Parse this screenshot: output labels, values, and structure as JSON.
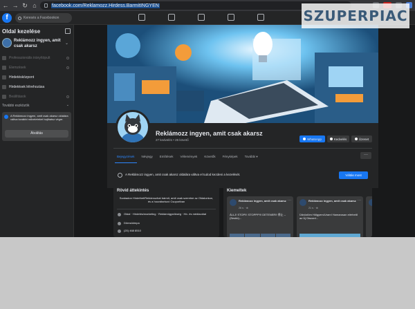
{
  "browser": {
    "url": "facebook.com/Reklamozz.Hirdess.BarmitINGYEN"
  },
  "watermark": "SZUPERPIAC",
  "fb": {
    "logo": "f",
    "search_placeholder": "Keresés a Facebookon"
  },
  "sidebar": {
    "title": "Oldal kezelése",
    "page_name": "Reklámozz ingyen, amit csak akarsz",
    "items": [
      {
        "label": "Professzionális irányítópult",
        "dim": true
      },
      {
        "label": "Elemzések",
        "dim": true
      },
      {
        "label": "Hirdetésközpont",
        "dim": false
      },
      {
        "label": "Hirdetések létrehozása",
        "dim": false
      },
      {
        "label": "Beállítások",
        "dim": true
      }
    ],
    "more_tools": "További eszközök",
    "notice_text": "A Reklámozz ingyen, amit csak akarsz oldalára váltva további műveleteket hajthatsz végre.",
    "switch_button": "Átváltás"
  },
  "page": {
    "name": "Reklámozz ingyen, amit csak akarsz",
    "stats": "27 kedvelés • 26 követő",
    "buttons": {
      "whatsapp": "WhatsApp",
      "like": "Kedvelés",
      "message": "Üzenet"
    },
    "tabs": [
      "Bejegyzések",
      "Névjegy",
      "Említések",
      "Vélemények",
      "Követők",
      "Fényképek",
      "További ▾"
    ],
    "tab_more": "···",
    "banner_text": "A Reklámozz ingyen, amit csak akarsz oldalára váltva el tudod kezdeni a kezelését.",
    "banner_button": "Váltás most"
  },
  "intro": {
    "title": "Rövid áttekintés",
    "description": "Szabadon Hirdethet/Reklámozhat bármit, amit csak szeretne az Oldalunkon, és a hozzátartozó Csoportban",
    "rows": [
      "Oldal · Hirdetés/marketing · Reklámügynökség · Hír- és médiaoldal",
      "Dömsödmpa",
      "(20) 468 8510"
    ]
  },
  "featured": {
    "title": "Kiemeltek",
    "posts": [
      {
        "author": "Reklámozz ingyen, amit csak akarsz",
        "date": "26 n. · ⊕",
        "text": "ÁLLJ! STOP!!! STOPPP!!! DETENER!! 停止 – (Sesitó)..."
      },
      {
        "author": "Reklámozz ingyen, amit csak akarsz",
        "date": "21 n. · ⊕",
        "text": "Üdvözlöm Hölgyem/Uram! Hamarosan elérhető az Új Discord..."
      }
    ]
  },
  "colors": {
    "accent": "#1877f2",
    "background": "#18191a",
    "surface": "#242526"
  }
}
